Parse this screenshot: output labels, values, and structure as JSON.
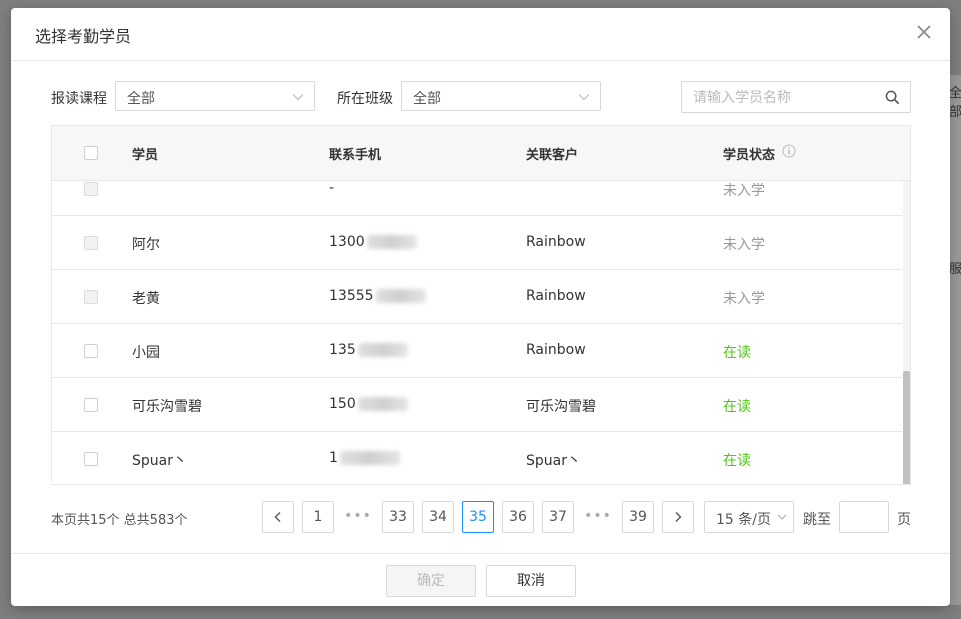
{
  "background": {
    "right_chars": [
      "全部",
      "服"
    ]
  },
  "modal": {
    "title": "选择考勤学员",
    "filters": {
      "course_label": "报读课程",
      "course_value": "全部",
      "class_label": "所在班级",
      "class_value": "全部",
      "search_placeholder": "请输入学员名称"
    },
    "table": {
      "headers": {
        "student": "学员",
        "phone": "联系手机",
        "customer": "关联客户",
        "status": "学员状态"
      },
      "rows": [
        {
          "student": "",
          "phone": "-",
          "customer": "",
          "status": "未入学",
          "status_color": "#999999"
        },
        {
          "student": "阿尔",
          "phone": "1300",
          "customer": "Rainbow",
          "status": "未入学",
          "status_color": "#999999"
        },
        {
          "student": "老黄",
          "phone": "13555",
          "customer": "Rainbow",
          "status": "未入学",
          "status_color": "#999999"
        },
        {
          "student": "小园",
          "phone": "135",
          "customer": "Rainbow",
          "status": "在读",
          "status_color": "#52c41a"
        },
        {
          "student": "可乐沟雪碧",
          "phone": "150",
          "customer": "可乐沟雪碧",
          "status": "在读",
          "status_color": "#52c41a"
        },
        {
          "student": "Spuar丶",
          "phone": "1",
          "customer": "Spuar丶",
          "status": "在读",
          "status_color": "#52c41a"
        }
      ]
    },
    "pagination": {
      "summary": "本页共15个 总共583个",
      "pages": [
        "1",
        "33",
        "34",
        "35",
        "36",
        "37",
        "39"
      ],
      "ellipsis": "•••",
      "current": "35",
      "page_size": "15 条/页",
      "jump_label": "跳至",
      "page_unit": "页"
    },
    "footer": {
      "confirm": "确定",
      "cancel": "取消"
    }
  },
  "colors": {
    "accent": "#1890ff",
    "success": "#52c41a",
    "muted": "#999999"
  }
}
